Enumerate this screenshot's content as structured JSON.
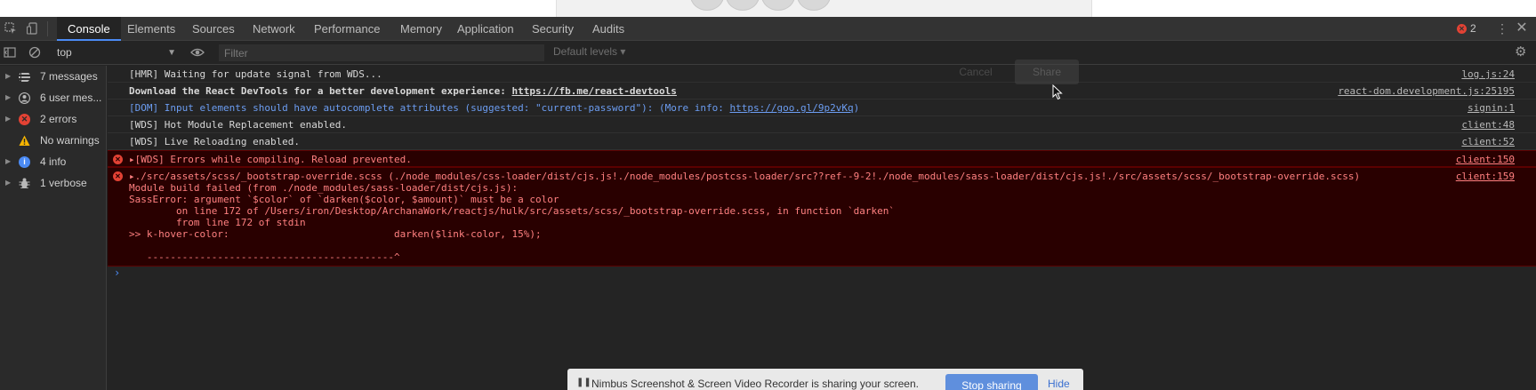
{
  "tabs": [
    {
      "label": "Console"
    },
    {
      "label": "Elements"
    },
    {
      "label": "Sources"
    },
    {
      "label": "Network"
    },
    {
      "label": "Performance"
    },
    {
      "label": "Memory"
    },
    {
      "label": "Application"
    },
    {
      "label": "Security"
    },
    {
      "label": "Audits"
    }
  ],
  "error_badge": {
    "count": "2",
    "icon": "error-icon"
  },
  "filter": {
    "context": "top",
    "placeholder": "Filter",
    "levels": "Default levels ▾"
  },
  "sidebar": {
    "items": [
      {
        "label": "7 messages",
        "icon": "list-icon"
      },
      {
        "label": "6 user mes...",
        "icon": "user-icon"
      },
      {
        "label": "2 errors",
        "icon": "error-icon"
      },
      {
        "label": "No warnings",
        "icon": "warning-icon"
      },
      {
        "label": "4 info",
        "icon": "info-icon"
      },
      {
        "label": "1 verbose",
        "icon": "bug-icon"
      }
    ]
  },
  "messages": [
    {
      "text": "[HMR] Waiting for update signal from WDS...",
      "source": "log.js:24"
    },
    {
      "text_prefix": "Download the React DevTools for a better development experience: ",
      "link": "https://fb.me/react-devtools",
      "source": "react-dom.development.js:25195"
    },
    {
      "text_prefix": "[DOM] Input elements should have autocomplete attributes (suggested: \"current-password\"): (More info: ",
      "link": "https://goo.gl/9p2vKq",
      "text_suffix": ")",
      "source": "signin:1"
    },
    {
      "text": "[WDS] Hot Module Replacement enabled.",
      "source": "client:48"
    },
    {
      "text": "[WDS] Live Reloading enabled.",
      "source": "client:52"
    }
  ],
  "errors": [
    {
      "text": "▸[WDS] Errors while compiling. Reload prevented.",
      "source": "client:150"
    },
    {
      "lines": [
        "▸./src/assets/scss/_bootstrap-override.scss (./node_modules/css-loader/dist/cjs.js!./node_modules/postcss-loader/src??ref--9-2!./node_modules/sass-loader/dist/cjs.js!./src/assets/scss/_bootstrap-override.scss)",
        "Module build failed (from ./node_modules/sass-loader/dist/cjs.js):",
        "SassError: argument `$color` of `darken($color, $amount)` must be a color",
        "        on line 172 of /Users/iron/Desktop/ArchanaWork/reactjs/hulk/src/assets/scss/_bootstrap-override.scss, in function `darken`",
        "        from line 172 of stdin",
        ">> k-hover-color:                            darken($link-color, 15%);",
        "",
        "   ------------------------------------------^"
      ],
      "source": "client:159"
    }
  ],
  "prompt": "›",
  "page_overlay": {
    "cancel": "Cancel",
    "share": "Share"
  },
  "share_bar": {
    "text": "Nimbus Screenshot & Screen Video Recorder is sharing your screen.",
    "stop": "Stop sharing",
    "hide": "Hide"
  },
  "colors": {
    "accent": "#4b8bf5",
    "error": "#e34234",
    "error_bg": "#290000",
    "warning": "#f5b400",
    "info": "#4b8bf5"
  }
}
